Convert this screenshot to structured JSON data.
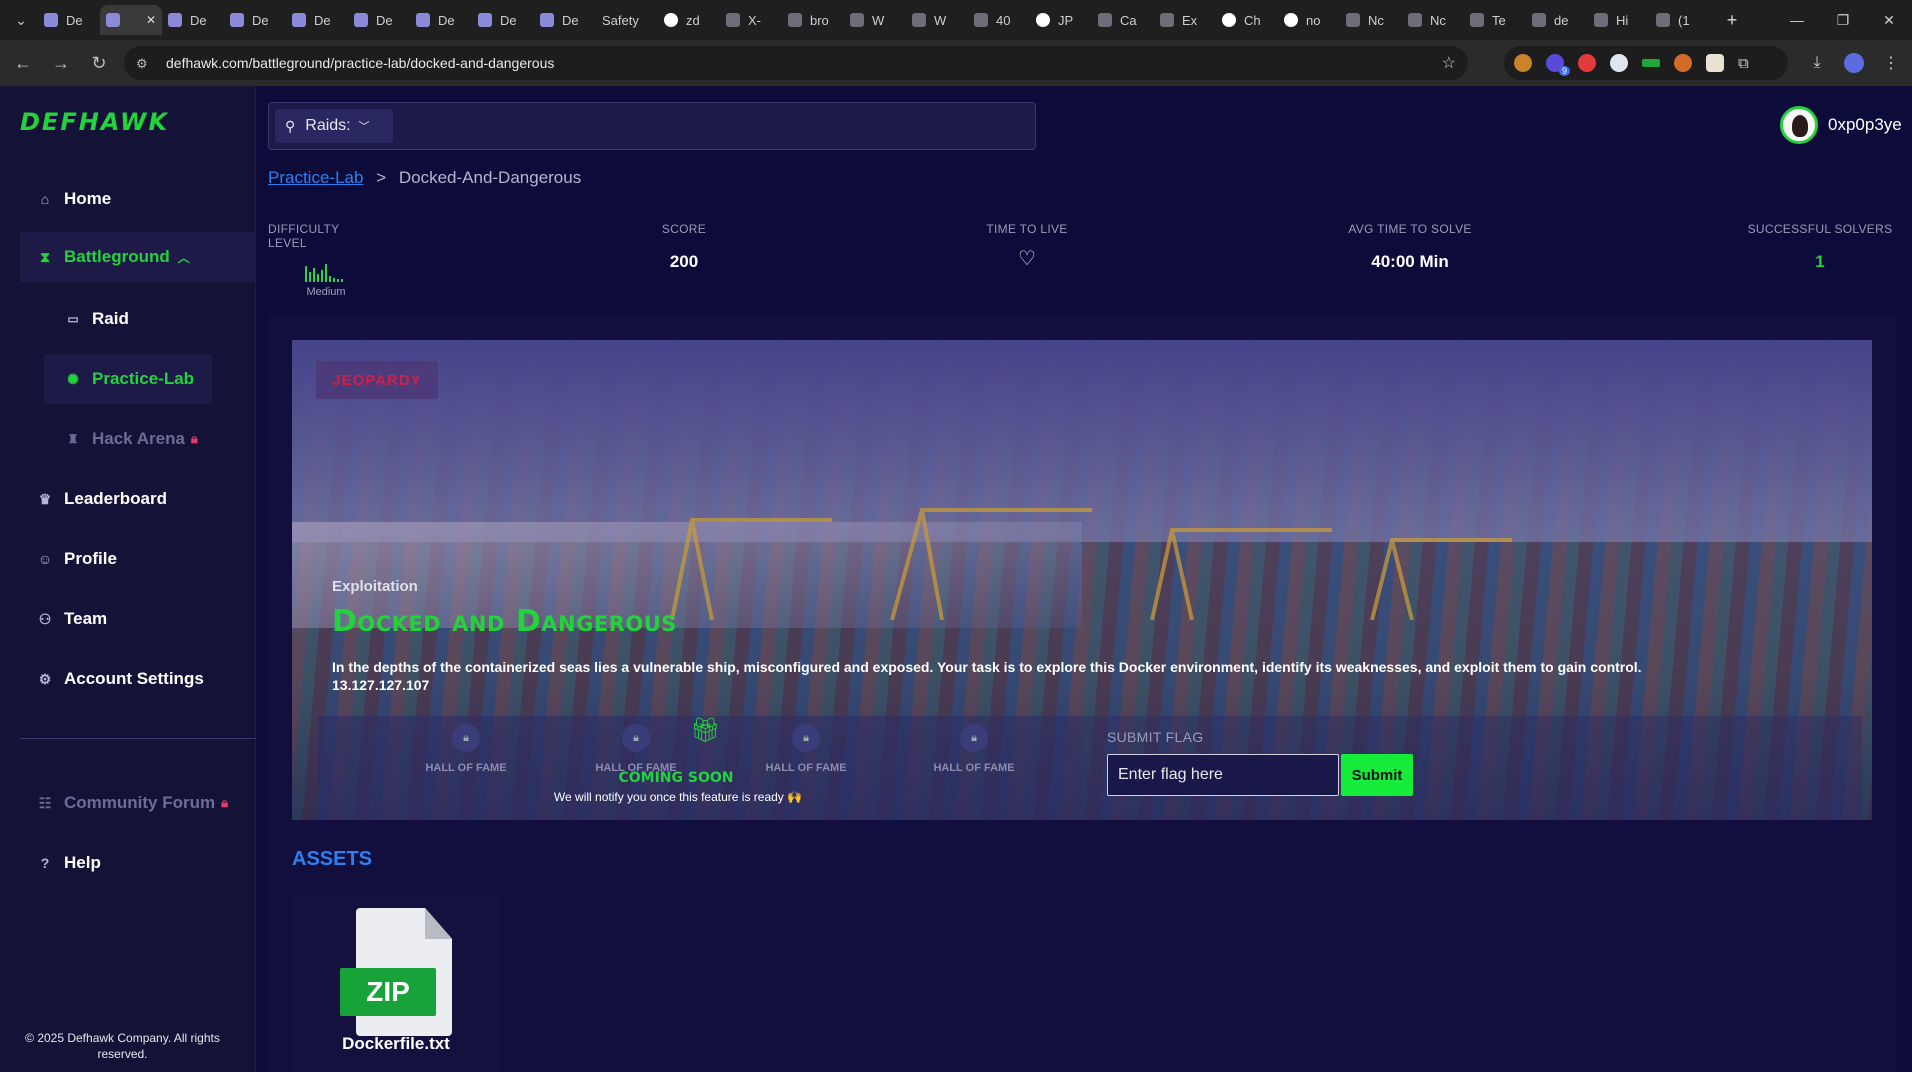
{
  "browser": {
    "tabs": [
      {
        "title": "De",
        "icon": "defhawk-shield-icon",
        "active": false
      },
      {
        "title": "De",
        "icon": "defhawk-shield-icon",
        "active": true
      },
      {
        "title": "De",
        "icon": "defhawk-shield-icon",
        "active": false
      },
      {
        "title": "De",
        "icon": "defhawk-shield-icon",
        "active": false
      },
      {
        "title": "De",
        "icon": "defhawk-shield-icon",
        "active": false
      },
      {
        "title": "De",
        "icon": "defhawk-shield-icon",
        "active": false
      },
      {
        "title": "De",
        "icon": "defhawk-shield-icon",
        "active": false
      },
      {
        "title": "De",
        "icon": "defhawk-shield-icon",
        "active": false
      },
      {
        "title": "De",
        "icon": "defhawk-shield-icon",
        "active": false
      },
      {
        "title": "Safety",
        "icon": "blank-icon",
        "active": false
      },
      {
        "title": "zd",
        "icon": "google-icon",
        "active": false
      },
      {
        "title": "X-",
        "icon": "blank-icon",
        "active": false
      },
      {
        "title": "bro",
        "icon": "globe-icon",
        "active": false
      },
      {
        "title": "W",
        "icon": "wikipedia-icon",
        "active": false
      },
      {
        "title": "W",
        "icon": "wikipedia-icon",
        "active": false
      },
      {
        "title": "40",
        "icon": "globe-icon",
        "active": false
      },
      {
        "title": "JP",
        "icon": "google-icon",
        "active": false
      },
      {
        "title": "Ca",
        "icon": "blank-icon",
        "active": false
      },
      {
        "title": "Ex",
        "icon": "app-icon",
        "active": false
      },
      {
        "title": "Ch",
        "icon": "openai-icon",
        "active": false
      },
      {
        "title": "no",
        "icon": "google-icon",
        "active": false
      },
      {
        "title": "Nc",
        "icon": "medium-icon",
        "active": false
      },
      {
        "title": "Nc",
        "icon": "app-icon",
        "active": false
      },
      {
        "title": "Te",
        "icon": "globe-icon",
        "active": false
      },
      {
        "title": "de",
        "icon": "blank-icon",
        "active": false
      },
      {
        "title": "Hi",
        "icon": "history-icon",
        "active": false
      },
      {
        "title": "(1",
        "icon": "app-icon",
        "active": false
      }
    ],
    "url": "defhawk.com/battleground/practice-lab/docked-and-dangerous",
    "extension_count": "9"
  },
  "brand": {
    "logo": "DEFHAWK",
    "accent": "#22d33c",
    "link": "#2f7ff0"
  },
  "sidebar": {
    "home": "Home",
    "battleground": "Battleground",
    "raid": "Raid",
    "practice_lab": "Practice-Lab",
    "hack_arena": "Hack Arena",
    "leaderboard": "Leaderboard",
    "profile": "Profile",
    "team": "Team",
    "account_settings": "Account Settings",
    "community_forum": "Community Forum",
    "help": "Help",
    "copyright": "© 2025 Defhawk Company. All rights reserved."
  },
  "search": {
    "dropdown_label": "Raids:"
  },
  "user": {
    "name": "0xp0p3ye"
  },
  "breadcrumb": {
    "parent": "Practice-Lab",
    "separator": ">",
    "current": "Docked-And-Dangerous"
  },
  "stats": {
    "difficulty_label": "DIFFICULTY LEVEL",
    "difficulty_value": "Medium",
    "score_label": "SCORE",
    "score_value": "200",
    "ttl_label": "TIME TO LIVE",
    "avg_label": "AVG TIME TO SOLVE",
    "avg_value": "40:00 Min",
    "solvers_label": "SUCCESSFUL SOLVERS",
    "solvers_value": "1"
  },
  "challenge": {
    "badge": "JEOPARDY",
    "category": "Exploitation",
    "title": "Docked and Dangerous",
    "description": "In the depths of the containerized seas lies a vulnerable ship, misconfigured and exposed. Your task is to explore this Docker environment, identify its weaknesses, and exploit them to gain control.",
    "ip": "13.127.127.107"
  },
  "hall_of_fame": {
    "items": [
      "HALL OF FAME",
      "HALL OF FAME",
      "HALL OF FAME",
      "HALL OF FAME"
    ],
    "coming_soon": "COMING SOON",
    "notice": "We will notify you once this feature is ready 🙌"
  },
  "flag": {
    "label": "SUBMIT FLAG",
    "placeholder": "Enter flag here",
    "submit": "Submit"
  },
  "assets": {
    "title": "ASSETS",
    "file_type": "ZIP",
    "file_name": "Dockerfile.txt"
  }
}
